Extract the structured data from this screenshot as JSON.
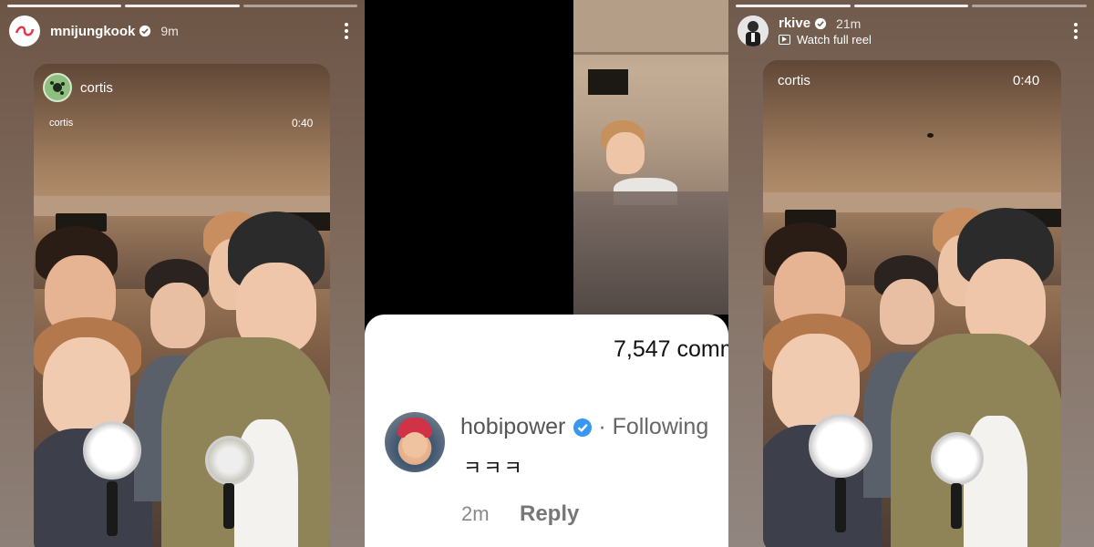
{
  "left_story": {
    "username": "mnijungkook",
    "time": "9m",
    "reel": {
      "brand_name": "cortis",
      "overlay_name": "cortis",
      "duration": "0:40"
    }
  },
  "middle": {
    "comments": {
      "count_text": "7,547 comm",
      "comment": {
        "username": "hobipower",
        "follow_status": "· Following",
        "text": "ㅋㅋㅋ",
        "time": "2m",
        "reply_label": "Reply"
      }
    }
  },
  "right_story": {
    "username": "rkive",
    "time": "21m",
    "subline": "Watch full reel",
    "reel": {
      "overlay_name": "cortis",
      "duration": "0:40"
    }
  },
  "colors": {
    "verified_white": "#ffffff",
    "verified_blue": "#3897f0",
    "brand_red": "#e03a4a"
  }
}
